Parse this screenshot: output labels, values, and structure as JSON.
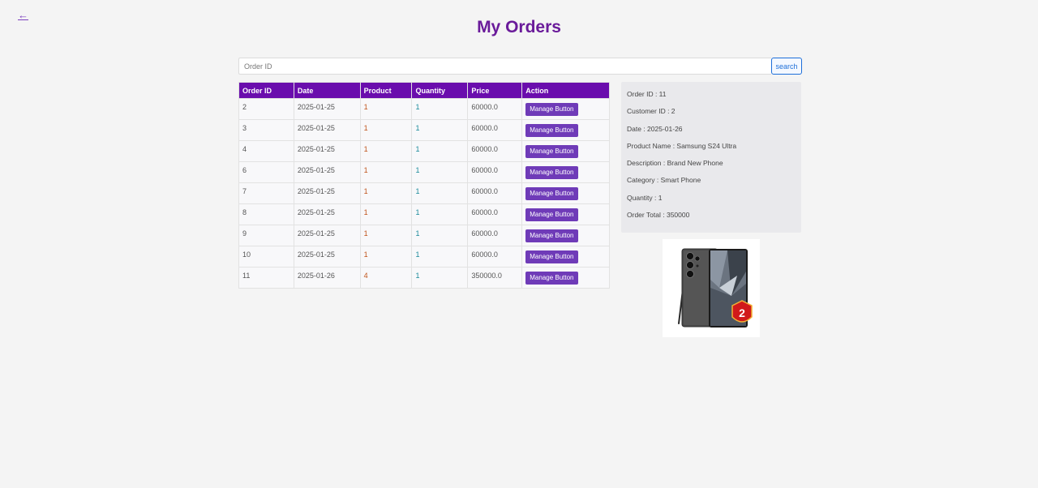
{
  "nav": {
    "back_icon": "←"
  },
  "title": "My Orders",
  "search": {
    "placeholder": "Order ID",
    "value": "",
    "button_label": "search"
  },
  "table": {
    "headers": [
      "Order ID",
      "Date",
      "Product",
      "Quantity",
      "Price",
      "Action"
    ],
    "rows": [
      {
        "order_id": "2",
        "date": "2025-01-25",
        "product": "1",
        "quantity": "1",
        "price": "60000.0",
        "action": "Manage Button"
      },
      {
        "order_id": "3",
        "date": "2025-01-25",
        "product": "1",
        "quantity": "1",
        "price": "60000.0",
        "action": "Manage Button"
      },
      {
        "order_id": "4",
        "date": "2025-01-25",
        "product": "1",
        "quantity": "1",
        "price": "60000.0",
        "action": "Manage Button"
      },
      {
        "order_id": "6",
        "date": "2025-01-25",
        "product": "1",
        "quantity": "1",
        "price": "60000.0",
        "action": "Manage Button"
      },
      {
        "order_id": "7",
        "date": "2025-01-25",
        "product": "1",
        "quantity": "1",
        "price": "60000.0",
        "action": "Manage Button"
      },
      {
        "order_id": "8",
        "date": "2025-01-25",
        "product": "1",
        "quantity": "1",
        "price": "60000.0",
        "action": "Manage Button"
      },
      {
        "order_id": "9",
        "date": "2025-01-25",
        "product": "1",
        "quantity": "1",
        "price": "60000.0",
        "action": "Manage Button"
      },
      {
        "order_id": "10",
        "date": "2025-01-25",
        "product": "1",
        "quantity": "1",
        "price": "60000.0",
        "action": "Manage Button"
      },
      {
        "order_id": "11",
        "date": "2025-01-26",
        "product": "4",
        "quantity": "1",
        "price": "350000.0",
        "action": "Manage Button"
      }
    ]
  },
  "details": {
    "order_id": "Order ID : 11",
    "customer_id": "Customer ID : 2",
    "date": "Date : 2025-01-26",
    "product_name": "Product Name : Samsung S24 Ultra",
    "description": "Description : Brand New Phone",
    "category": "Category : Smart Phone",
    "quantity": "Quantity : 1",
    "order_total": "Order Total : 350000"
  },
  "product_image": {
    "badge_text": "2"
  },
  "colors": {
    "accent": "#6a0dad",
    "title": "#6a1b9a",
    "button": "#6f3bb8",
    "search_border": "#1e6fd9"
  }
}
